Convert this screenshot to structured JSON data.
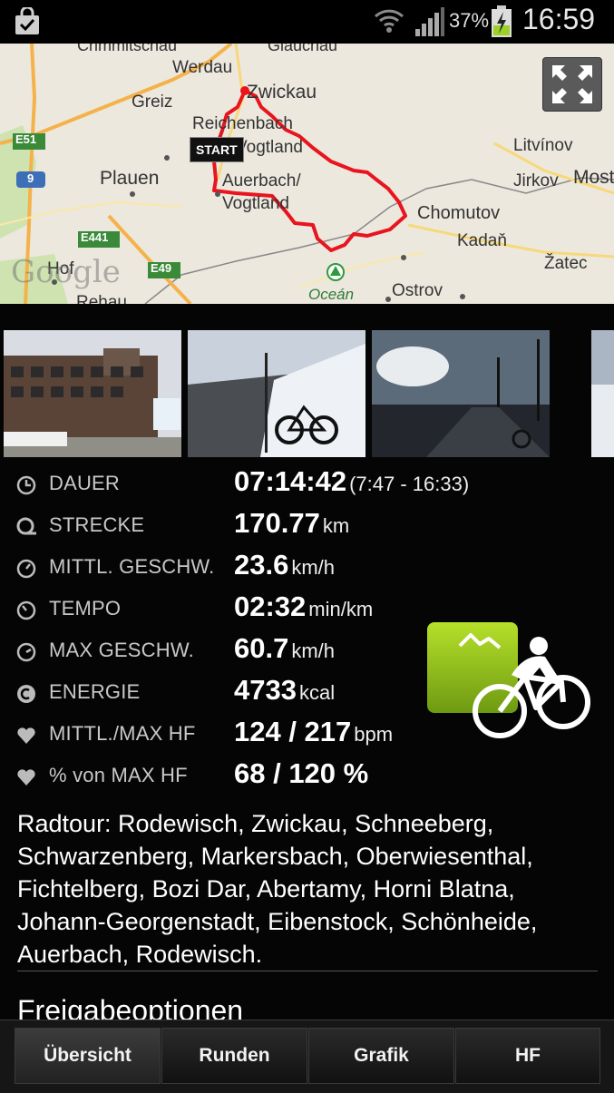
{
  "status_bar": {
    "battery_percent": "37%",
    "time": "16:59",
    "icons": [
      "shopping-bag-icon",
      "wifi-icon",
      "signal-icon",
      "battery-charging-icon"
    ]
  },
  "map": {
    "start_label": "START",
    "attribution": "Google",
    "places": [
      {
        "name": "Werdau"
      },
      {
        "name": "Zwickau"
      },
      {
        "name": "Greiz"
      },
      {
        "name": "Reichenbach"
      },
      {
        "name": "Vogtland"
      },
      {
        "name": "Plauen"
      },
      {
        "name": "Auerbach/"
      },
      {
        "name": "Vogtland"
      },
      {
        "name": "Litvínov"
      },
      {
        "name": "Jirkov"
      },
      {
        "name": "Most"
      },
      {
        "name": "Chomutov"
      },
      {
        "name": "Kadaň"
      },
      {
        "name": "Žatec"
      },
      {
        "name": "Hof"
      },
      {
        "name": "Oceán"
      },
      {
        "name": "Ostrov"
      },
      {
        "name": "Rehau"
      },
      {
        "name": "Crimmitschau"
      },
      {
        "name": "Glauchau"
      }
    ],
    "roads": [
      "E51",
      "9",
      "E441",
      "E49"
    ]
  },
  "photos": [
    "building-photo",
    "bike-snow-photo",
    "sunset-road-photo",
    "snow-photo-partial"
  ],
  "stats": [
    {
      "label": "DAUER",
      "value": "07:14:42",
      "unit": "(7:47 - 16:33)",
      "icon": "clock-icon"
    },
    {
      "label": "STRECKE",
      "value": "170.77",
      "unit": "km",
      "icon": "distance-icon"
    },
    {
      "label": "MITTL. GESCHW.",
      "value": "23.6",
      "unit": "km/h",
      "icon": "speedometer-icon"
    },
    {
      "label": "TEMPO",
      "value": "02:32",
      "unit": "min/km",
      "icon": "tempo-icon"
    },
    {
      "label": "MAX GESCHW.",
      "value": "60.7",
      "unit": "km/h",
      "icon": "max-speed-icon"
    },
    {
      "label": "ENERGIE",
      "value": "4733",
      "unit": "kcal",
      "icon": "energy-icon"
    },
    {
      "label": "MITTL./MAX HF",
      "value": "124 / 217",
      "unit": "bpm",
      "icon": "heart-icon"
    },
    {
      "label": "% von MAX HF",
      "value": "68 / 120 %",
      "unit": "",
      "icon": "heart-icon"
    }
  ],
  "sport_icon": "cycling-icon",
  "description": "Radtour: Rodewisch, Zwickau, Schneeberg, Schwarzenberg, Markersbach, Oberwiesenthal, Fichtelberg, Bozi Dar, Abertamy, Horni Blatna, Johann-Georgenstadt, Eibenstock, Schönheide, Auerbach, Rodewisch.",
  "section_title": "Freigabeoptionen",
  "tabs": [
    {
      "label": "Übersicht",
      "active": true
    },
    {
      "label": "Runden",
      "active": false
    },
    {
      "label": "Grafik",
      "active": false
    },
    {
      "label": "HF",
      "active": false
    }
  ],
  "colors": {
    "route": "#e8141e",
    "map_background": "#ece8de",
    "sport_green": "#9ccc1c"
  }
}
